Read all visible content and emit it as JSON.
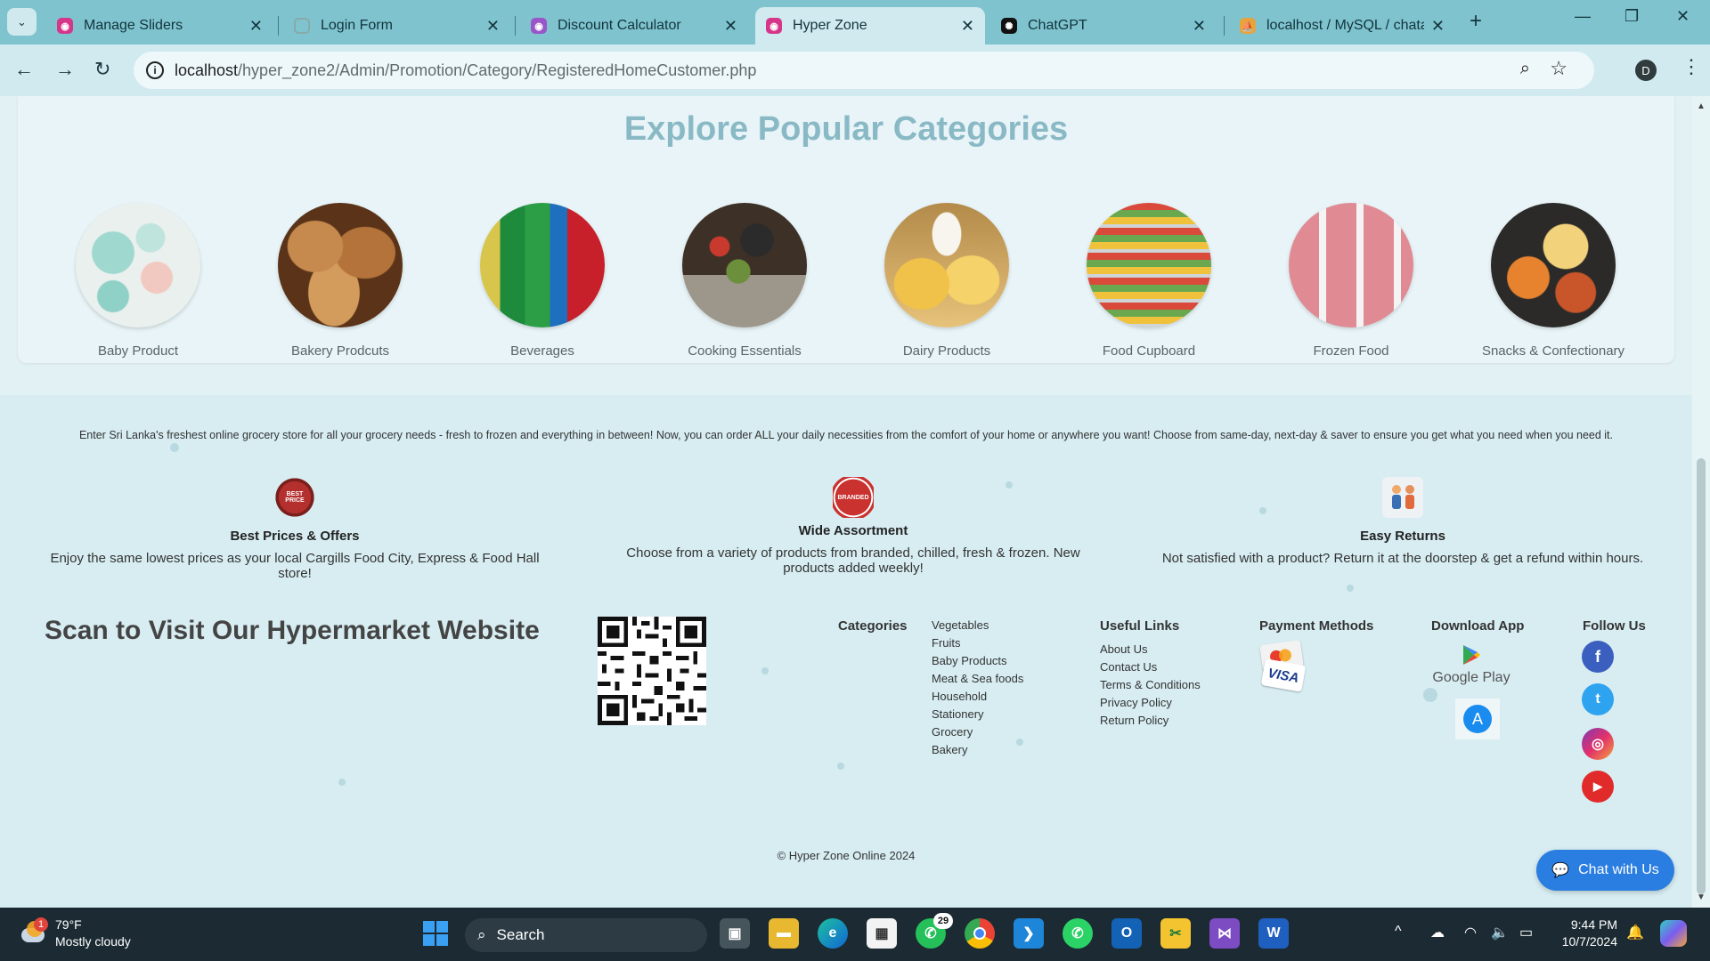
{
  "browser": {
    "tabs": [
      {
        "title": "Manage Sliders",
        "active": false
      },
      {
        "title": "Login Form",
        "active": false
      },
      {
        "title": "Discount Calculator",
        "active": false
      },
      {
        "title": "Hyper Zone",
        "active": true
      },
      {
        "title": "ChatGPT",
        "active": false
      },
      {
        "title": "localhost / MySQL / chatap",
        "active": false
      }
    ],
    "url_host": "localhost",
    "url_path": "/hyper_zone2/Admin/Promotion/Category/RegisteredHomeCustomer.php",
    "profile_initial": "D"
  },
  "categories": {
    "title": "Explore Popular Categories",
    "items": [
      {
        "label": "Baby Product",
        "icon": "baby-products-image"
      },
      {
        "label": "Bakery Prodcuts",
        "icon": "bread-image"
      },
      {
        "label": "Beverages",
        "icon": "soda-bottles-image"
      },
      {
        "label": "Cooking Essentials",
        "icon": "cooking-ingredients-image"
      },
      {
        "label": "Dairy Products",
        "icon": "milk-cheese-image"
      },
      {
        "label": "Food Cupboard",
        "icon": "grocery-shelf-image"
      },
      {
        "label": "Frozen Food",
        "icon": "frozen-meat-trays-image"
      },
      {
        "label": "Snacks & Confectionary",
        "icon": "snack-bowls-image"
      }
    ]
  },
  "footer": {
    "description": "Enter Sri Lanka's freshest online grocery store for all your grocery needs - fresh to frozen and everything in between! Now, you can order ALL your daily necessities from the comfort of your home or anywhere you want! Choose from same-day, next-day & saver to ensure you get what you need when you need it.",
    "features": [
      {
        "title": "Best Prices & Offers",
        "text": "Enjoy the same lowest prices as your local Cargills Food City, Express & Food Hall store!",
        "icon_text": "BEST PRICE"
      },
      {
        "title": "Wide Assortment",
        "text": "Choose from a variety of products from branded, chilled, fresh & frozen. New products added weekly!",
        "icon_text": "BRANDED"
      },
      {
        "title": "Easy Returns",
        "text": "Not satisfied with a product? Return it at the doorstep & get a refund within hours.",
        "icon_text": ""
      }
    ],
    "scan_title": "Scan to Visit Our Hypermarket Website",
    "categories_head": "Categories",
    "categories_links": [
      "Vegetables",
      "Fruits",
      "Baby Products",
      "Meat & Sea foods",
      "Household",
      "Stationery",
      "Grocery",
      "Bakery"
    ],
    "useful_head": "Useful Links",
    "useful_links": [
      "About Us",
      "Contact Us",
      "Terms & Conditions",
      "Privacy Policy",
      "Return Policy"
    ],
    "payment_head": "Payment Methods",
    "payment_icons": [
      "mastercard-icon",
      "visa-icon"
    ],
    "payment_card_text": "VISA",
    "download_head": "Download App",
    "google_play": "Google Play",
    "follow_head": "Follow Us",
    "social": [
      "facebook-icon",
      "twitter-icon",
      "instagram-icon",
      "youtube-icon"
    ],
    "copyright": "© Hyper Zone Online 2024",
    "chat_label": "Chat with Us"
  },
  "taskbar": {
    "temperature": "79°F",
    "weather": "Mostly cloudy",
    "weather_badge": "1",
    "search_label": "Search",
    "whatsapp_badge": "29",
    "time": "9:44 PM",
    "date": "10/7/2024"
  },
  "colors": {
    "accent": "#2a7de1",
    "title": "#8ab9c6",
    "tabbar": "#7fc3cf",
    "taskbar": "#1c2b33"
  }
}
